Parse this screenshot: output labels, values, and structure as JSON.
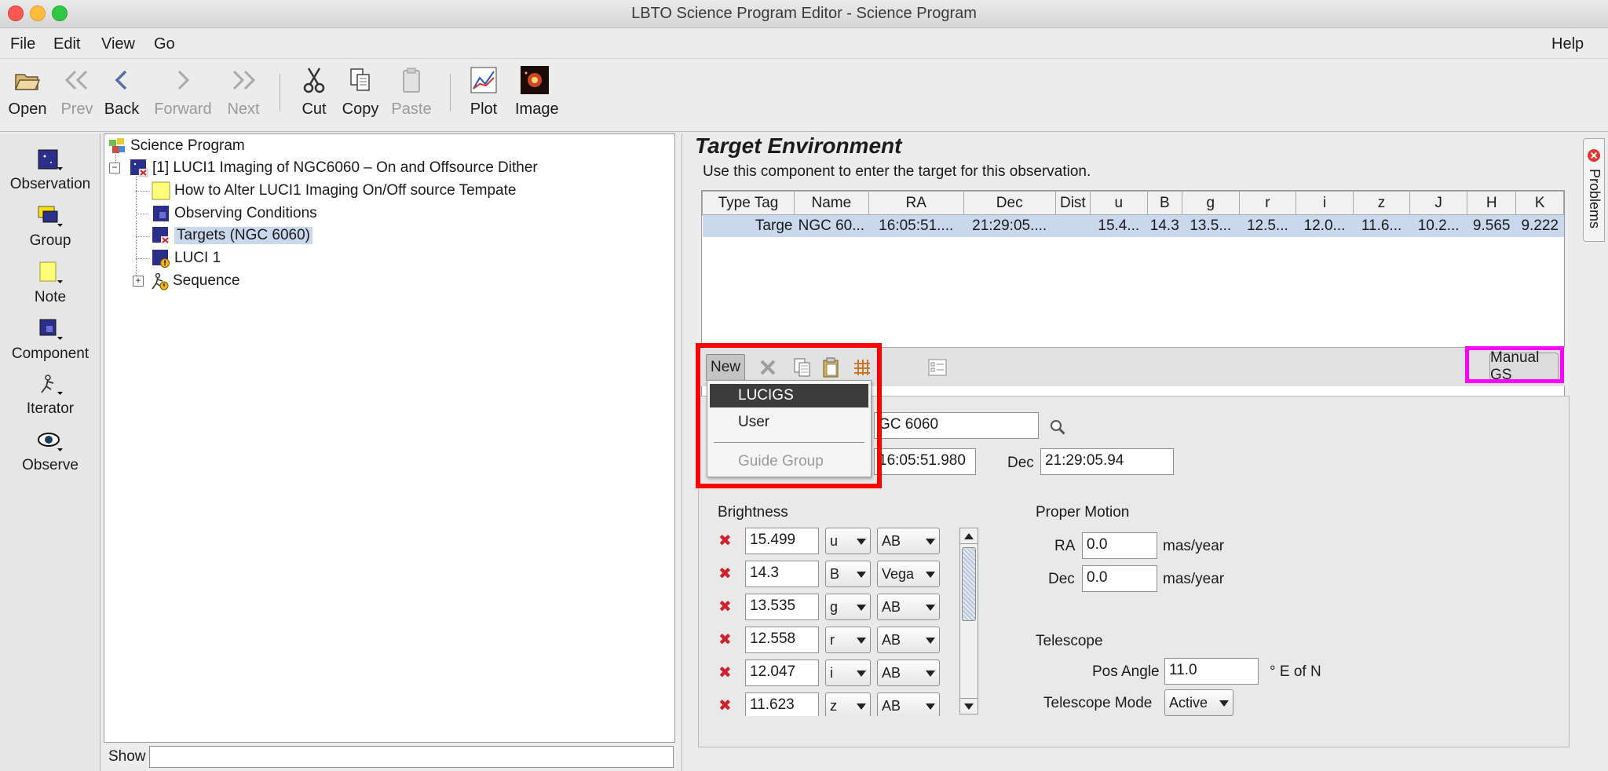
{
  "window": {
    "title": "LBTO Science Program Editor - Science Program"
  },
  "menubar": {
    "file": "File",
    "edit": "Edit",
    "view": "View",
    "go": "Go",
    "help": "Help"
  },
  "toolbar": {
    "open": "Open",
    "prev": "Prev",
    "back": "Back",
    "forward": "Forward",
    "next": "Next",
    "cut": "Cut",
    "copy": "Copy",
    "paste": "Paste",
    "plot": "Plot",
    "image": "Image"
  },
  "palette": {
    "observation": "Observation",
    "group": "Group",
    "note": "Note",
    "component": "Component",
    "iterator": "Iterator",
    "observe": "Observe"
  },
  "tree": {
    "root": "Science Program",
    "observation": "[1] LUCI1 Imaging of NGC6060 – On and Offsource Dither",
    "note": "How to Alter LUCI1 Imaging On/Off source Tempate",
    "conditions": "Observing Conditions",
    "targets": "Targets (NGC 6060)",
    "luci": "LUCI 1",
    "sequence": "Sequence"
  },
  "show": {
    "label": "Show",
    "value": ""
  },
  "target_env": {
    "title": "Target Environment",
    "description": "Use this component to enter the target for this observation.",
    "columns": [
      "Type Tag",
      "Name",
      "RA",
      "Dec",
      "Dist",
      "u",
      "B",
      "g",
      "r",
      "i",
      "z",
      "J",
      "H",
      "K"
    ],
    "rows": [
      [
        "Targe",
        "NGC 60...",
        "16:05:51....",
        "21:29:05....",
        "",
        "15.4...",
        "14.3",
        "13.5...",
        "12.5...",
        "12.0...",
        "11.6...",
        "10.2...",
        "9.565",
        "9.222"
      ]
    ],
    "new_button": "New",
    "manual_gs_button": "Manual GS"
  },
  "new_menu": {
    "items": [
      "LUCIGS",
      "User",
      "Guide Group"
    ]
  },
  "target_detail": {
    "name_value": "GC 6060",
    "ra_value": "16:05:51.980",
    "dec_label": "Dec",
    "dec_value": "21:29:05.94"
  },
  "brightness": {
    "title": "Brightness",
    "rows": [
      {
        "value": "15.499",
        "band": "u",
        "system": "AB"
      },
      {
        "value": "14.3",
        "band": "B",
        "system": "Vega"
      },
      {
        "value": "13.535",
        "band": "g",
        "system": "AB"
      },
      {
        "value": "12.558",
        "band": "r",
        "system": "AB"
      },
      {
        "value": "12.047",
        "band": "i",
        "system": "AB"
      },
      {
        "value": "11.623",
        "band": "z",
        "system": "AB"
      }
    ]
  },
  "proper_motion": {
    "title": "Proper Motion",
    "ra_label": "RA",
    "ra_value": "0.0",
    "dec_label": "Dec",
    "dec_value": "0.0",
    "unit": "mas/year"
  },
  "telescope": {
    "title": "Telescope",
    "pos_angle_label": "Pos Angle",
    "pos_angle_value": "11.0",
    "pos_angle_unit": "° E of N",
    "mode_label": "Telescope Mode",
    "mode_value": "Active"
  },
  "problems_tab": {
    "label": "Problems"
  },
  "colors": {
    "red_highlight": "#ff0000",
    "magenta_highlight": "#ff00ff",
    "selection": "#c9d8ec",
    "menu_selected": "#3a3a3a"
  }
}
